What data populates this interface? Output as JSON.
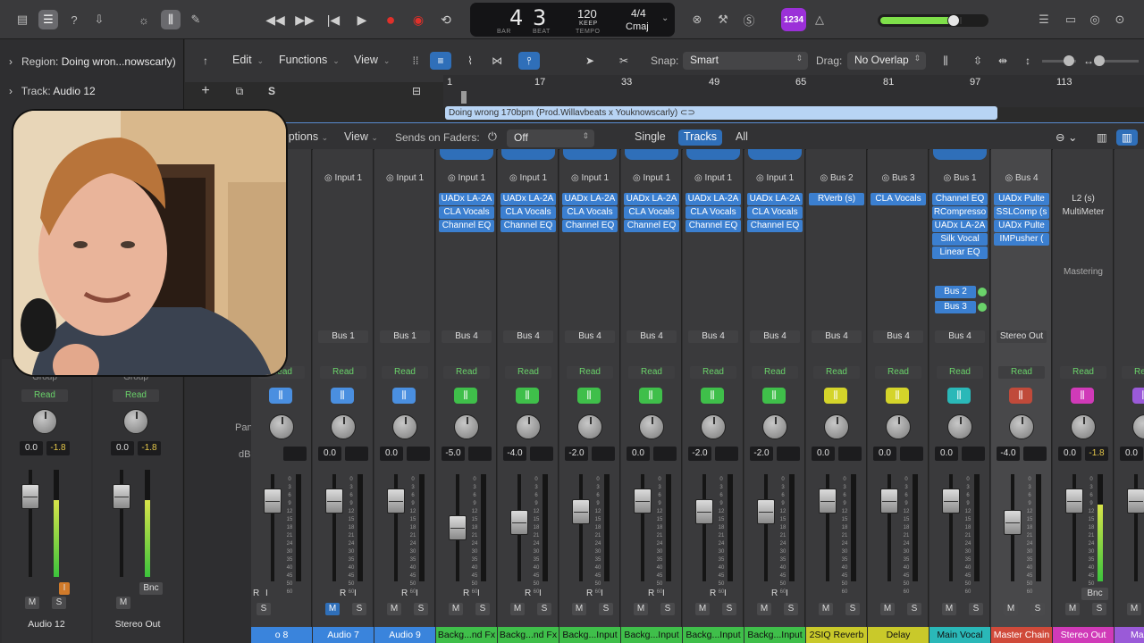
{
  "topbar": {
    "lcd": {
      "bar": "4",
      "beat": "3",
      "bar_label": "BAR",
      "beat_label": "BEAT",
      "tempo": "120",
      "tempo_mode": "KEEP",
      "tempo_label": "TEMPO",
      "signature": "4/4",
      "key": "Cmaj"
    },
    "badge": "1234"
  },
  "inspector": {
    "region_label": "Region:",
    "region_name": "Doing wron...nowscarly)",
    "track_label": "Track:",
    "track_name": "Audio 12"
  },
  "toolbar": {
    "edit": "Edit",
    "functions": "Functions",
    "view": "View",
    "snap_label": "Snap:",
    "snap_value": "Smart",
    "drag_label": "Drag:",
    "drag_value": "No Overlap",
    "s_button": "S"
  },
  "ruler": {
    "ticks": [
      "1",
      "17",
      "33",
      "49",
      "65",
      "81",
      "97",
      "113"
    ]
  },
  "region": {
    "name": "Doing wrong 170bpm (Prod.Willavbeats x Youknowscarly)"
  },
  "mixer_bar": {
    "options": "Options",
    "view": "View",
    "sends_label": "Sends on Faders:",
    "sends_value": "Off",
    "single": "Single",
    "tracks": "Tracks",
    "all": "All"
  },
  "row_labels": {
    "pan": "Pan",
    "db": "dB"
  },
  "left_strips": [
    {
      "name": "Audio 12",
      "auto": "Read",
      "vol": "0.0",
      "peak": "-1.8",
      "extra": "Group"
    },
    {
      "name": "Stereo Out",
      "auto": "Read",
      "vol": "0.0",
      "peak": "-1.8",
      "extra": "Group",
      "bnc": "Bnc"
    }
  ],
  "strips": [
    {
      "name": "o 8",
      "input": "",
      "out": "",
      "auto": "Read",
      "vol": "",
      "inserts": [],
      "color": "#4a8fe0",
      "tile": "#4a8fe0"
    },
    {
      "name": "Audio 7",
      "input": "Input 1",
      "out": "Bus 1",
      "auto": "Read",
      "vol": "0.0",
      "inserts": [],
      "color": "#4a8fe0",
      "tile": "#4a8fe0"
    },
    {
      "name": "Audio 9",
      "input": "Input 1",
      "out": "Bus 1",
      "auto": "Read",
      "vol": "0.0",
      "inserts": [],
      "color": "#4a8fe0",
      "tile": "#4a8fe0"
    },
    {
      "name": "Backg...nd Fx",
      "input": "Input 1",
      "out": "Bus 4",
      "auto": "Read",
      "vol": "-5.0",
      "inserts": [
        "UADx LA-2A",
        "CLA Vocals",
        "Channel EQ"
      ],
      "color": "#3fbf4a",
      "tile": "#3fbf4a"
    },
    {
      "name": "Backg...nd Fx",
      "input": "Input 1",
      "out": "Bus 4",
      "auto": "Read",
      "vol": "-4.0",
      "inserts": [
        "UADx LA-2A",
        "CLA Vocals",
        "Channel EQ"
      ],
      "color": "#3fbf4a",
      "tile": "#3fbf4a"
    },
    {
      "name": "Backg...Input",
      "input": "Input 1",
      "out": "Bus 4",
      "auto": "Read",
      "vol": "-2.0",
      "inserts": [
        "UADx LA-2A",
        "CLA Vocals",
        "Channel EQ"
      ],
      "color": "#3fbf4a",
      "tile": "#3fbf4a"
    },
    {
      "name": "Backg...Input",
      "input": "Input 1",
      "out": "Bus 4",
      "auto": "Read",
      "vol": "0.0",
      "inserts": [
        "UADx LA-2A",
        "CLA Vocals",
        "Channel EQ"
      ],
      "color": "#3fbf4a",
      "tile": "#3fbf4a"
    },
    {
      "name": "Backg...Input",
      "input": "Input 1",
      "out": "Bus 4",
      "auto": "Read",
      "vol": "-2.0",
      "inserts": [
        "UADx LA-2A",
        "CLA Vocals",
        "Channel EQ"
      ],
      "color": "#3fbf4a",
      "tile": "#3fbf4a"
    },
    {
      "name": "Backg...Input",
      "input": "Input 1",
      "out": "Bus 4",
      "auto": "Read",
      "vol": "-2.0",
      "inserts": [
        "UADx LA-2A",
        "CLA Vocals",
        "Channel EQ"
      ],
      "color": "#3fbf4a",
      "tile": "#3fbf4a"
    },
    {
      "name": "2SIQ Reverb",
      "input": "Bus 2",
      "out": "Bus 4",
      "auto": "Read",
      "vol": "0.0",
      "inserts": [
        "RVerb (s)"
      ],
      "color": "#c9c92a",
      "tile": "#d4d42a"
    },
    {
      "name": "Delay",
      "input": "Bus 3",
      "out": "Bus 4",
      "auto": "Read",
      "vol": "0.0",
      "inserts": [
        "CLA Vocals"
      ],
      "color": "#c9c92a",
      "tile": "#d4d42a"
    },
    {
      "name": "Main Vocal",
      "input": "Bus 1",
      "out": "Bus 4",
      "auto": "Read",
      "vol": "0.0",
      "inserts": [
        "Channel EQ",
        "RCompresso",
        "UADx LA-2A",
        "Silk Vocal",
        "Linear EQ"
      ],
      "sends": [
        "Bus 2",
        "Bus 3"
      ],
      "color": "#2ab8b8",
      "tile": "#2ab8b8"
    },
    {
      "name": "Master Chain",
      "input": "Bus 4",
      "out": "Stereo Out",
      "auto": "Read",
      "vol": "-4.0",
      "inserts": [
        "UADx Pulte",
        "SSLComp (s",
        "UADx Pulte",
        "IMPusher ("
      ],
      "color": "#d04a3a",
      "tile": "#c04a3a"
    },
    {
      "name": "Stereo Out",
      "input": "",
      "out": "",
      "auto": "Read",
      "vol": "0.0",
      "peak": "-1.8",
      "inserts": [
        "L2 (s)",
        "MultiMeter"
      ],
      "label": "Mastering",
      "color": "#d03ab8",
      "tile": "#d03ab8",
      "bnc": "Bnc"
    },
    {
      "name": "Master",
      "input": "",
      "out": "",
      "auto": "Read",
      "vol": "0.0",
      "inserts": [],
      "color": "#9a5ad8",
      "tile": "#9a5ad8"
    }
  ],
  "buttons": {
    "m": "M",
    "s": "S",
    "r": "R",
    "i": "I",
    "d": "D"
  }
}
